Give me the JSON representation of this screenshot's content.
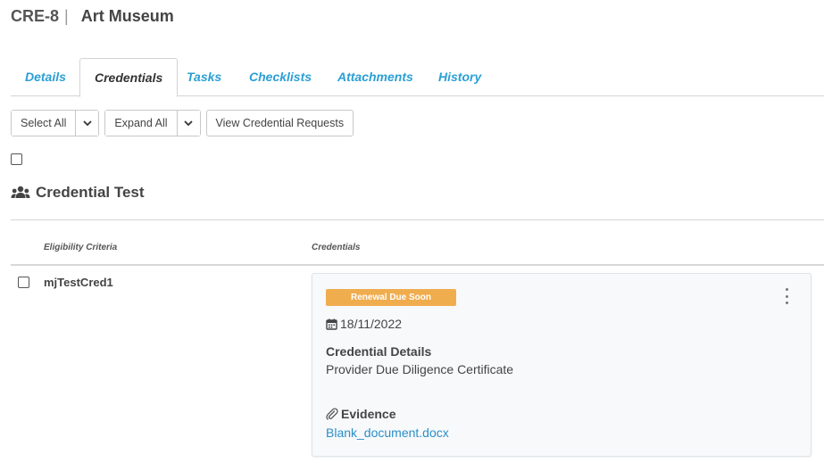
{
  "header": {
    "code": "CRE-8",
    "separator": "|",
    "title": "Art Museum"
  },
  "tabs": [
    {
      "label": "Details",
      "active": false
    },
    {
      "label": "Credentials",
      "active": true
    },
    {
      "label": "Tasks",
      "active": false
    },
    {
      "label": "Checklists",
      "active": false
    },
    {
      "label": "Attachments",
      "active": false
    },
    {
      "label": "History",
      "active": false
    }
  ],
  "toolbar": {
    "select_all_label": "Select All",
    "expand_all_label": "Expand All",
    "view_requests_label": "View Credential Requests"
  },
  "section": {
    "title": "Credential Test",
    "icon": "users-icon"
  },
  "table": {
    "columns": [
      "Eligibility Criteria",
      "Credentials"
    ],
    "rows": [
      {
        "name": "mjTestCred1",
        "credential": {
          "status_badge": "Renewal Due Soon",
          "date": "18/11/2022",
          "details_label": "Credential Details",
          "details_value": "Provider Due Diligence Certificate",
          "evidence_label": "Evidence",
          "evidence_file": "Blank_document.docx"
        }
      }
    ]
  },
  "colors": {
    "accent": "#2a9fd6",
    "link": "#2a8fc8",
    "badge": "#f0ad4e",
    "text": "#444444"
  }
}
